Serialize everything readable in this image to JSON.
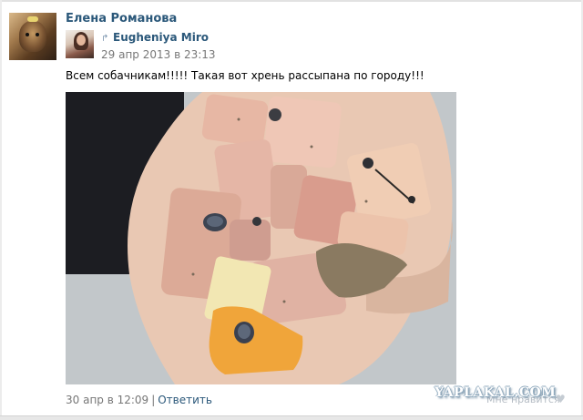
{
  "post": {
    "author_name": "Елена Романова",
    "repost": {
      "author_name": "Eugheniya Miro",
      "date": "29 апр 2013 в 23:13"
    },
    "text": "Всем собачникам!!!!! Такая вот хрень рассыпана по городу!!!",
    "footer": {
      "date": "30 апр в 12:09",
      "separator": "|",
      "reply_label": "Ответить",
      "like_label": "Мне нравится"
    }
  },
  "watermark": "YAPLAKAL.COM",
  "icons": {
    "repost": "repost-arrow-icon",
    "like": "heart-icon"
  },
  "colors": {
    "link": "#2b587a",
    "meta": "#777777"
  }
}
